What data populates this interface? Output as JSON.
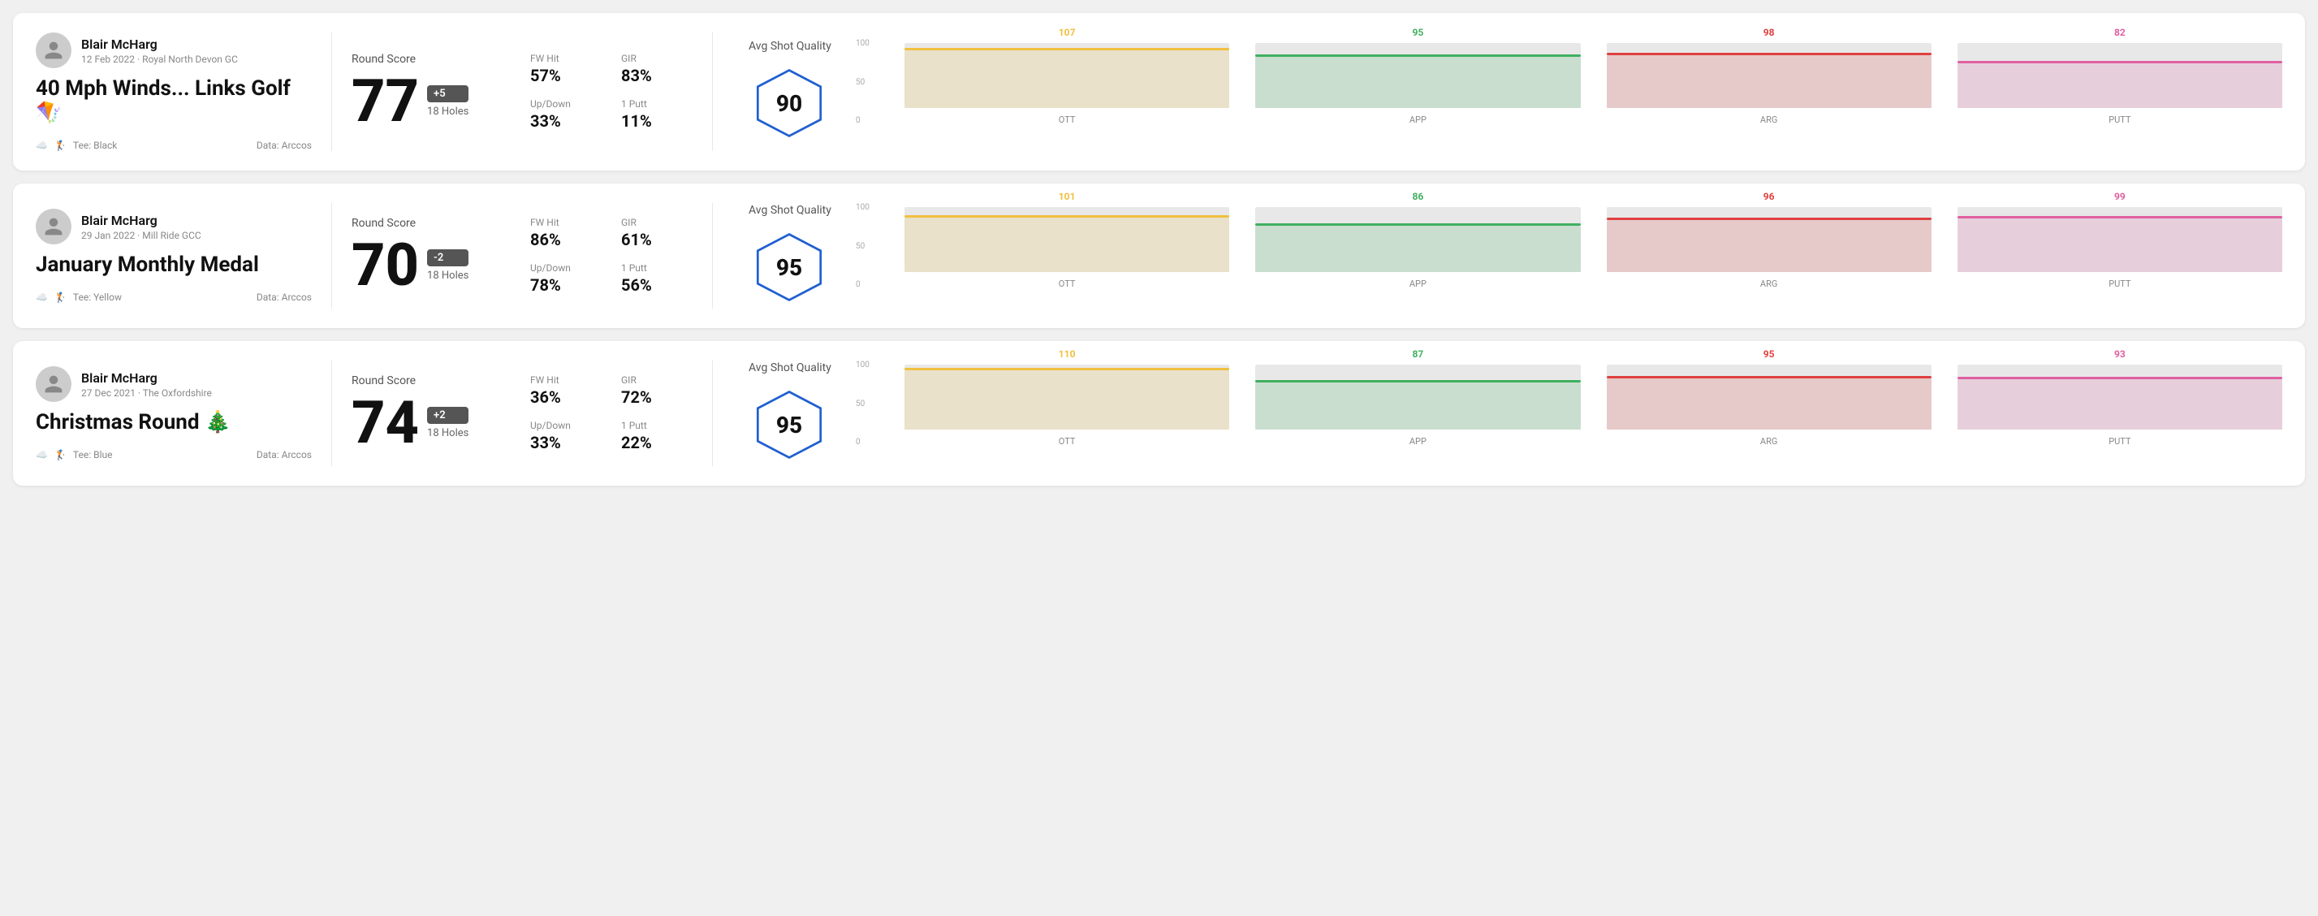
{
  "rounds": [
    {
      "player_name": "Blair McHarg",
      "date": "12 Feb 2022 · Royal North Devon GC",
      "title": "40 Mph Winds... Links Golf",
      "title_emoji": "🪁",
      "tee": "Black",
      "data_source": "Data: Arccos",
      "round_score_label": "Round Score",
      "score": "77",
      "score_diff": "+5",
      "holes": "18 Holes",
      "fw_hit_label": "FW Hit",
      "fw_hit": "57%",
      "gir_label": "GIR",
      "gir": "83%",
      "updown_label": "Up/Down",
      "updown": "33%",
      "oneputt_label": "1 Putt",
      "oneputt": "11%",
      "quality_label": "Avg Shot Quality",
      "quality_score": "90",
      "bars": [
        {
          "label": "OTT",
          "value": 107,
          "color": "#f0c040",
          "max": 120
        },
        {
          "label": "APP",
          "value": 95,
          "color": "#40b060",
          "max": 120
        },
        {
          "label": "ARG",
          "value": 98,
          "color": "#e04040",
          "max": 120
        },
        {
          "label": "PUTT",
          "value": 82,
          "color": "#e060a0",
          "max": 120
        }
      ]
    },
    {
      "player_name": "Blair McHarg",
      "date": "29 Jan 2022 · Mill Ride GCC",
      "title": "January Monthly Medal",
      "title_emoji": "",
      "tee": "Yellow",
      "data_source": "Data: Arccos",
      "round_score_label": "Round Score",
      "score": "70",
      "score_diff": "-2",
      "holes": "18 Holes",
      "fw_hit_label": "FW Hit",
      "fw_hit": "86%",
      "gir_label": "GIR",
      "gir": "61%",
      "updown_label": "Up/Down",
      "updown": "78%",
      "oneputt_label": "1 Putt",
      "oneputt": "56%",
      "quality_label": "Avg Shot Quality",
      "quality_score": "95",
      "bars": [
        {
          "label": "OTT",
          "value": 101,
          "color": "#f0c040",
          "max": 120
        },
        {
          "label": "APP",
          "value": 86,
          "color": "#40b060",
          "max": 120
        },
        {
          "label": "ARG",
          "value": 96,
          "color": "#e04040",
          "max": 120
        },
        {
          "label": "PUTT",
          "value": 99,
          "color": "#e060a0",
          "max": 120
        }
      ]
    },
    {
      "player_name": "Blair McHarg",
      "date": "27 Dec 2021 · The Oxfordshire",
      "title": "Christmas Round",
      "title_emoji": "🎄",
      "tee": "Blue",
      "data_source": "Data: Arccos",
      "round_score_label": "Round Score",
      "score": "74",
      "score_diff": "+2",
      "holes": "18 Holes",
      "fw_hit_label": "FW Hit",
      "fw_hit": "36%",
      "gir_label": "GIR",
      "gir": "72%",
      "updown_label": "Up/Down",
      "updown": "33%",
      "oneputt_label": "1 Putt",
      "oneputt": "22%",
      "quality_label": "Avg Shot Quality",
      "quality_score": "95",
      "bars": [
        {
          "label": "OTT",
          "value": 110,
          "color": "#f0c040",
          "max": 120
        },
        {
          "label": "APP",
          "value": 87,
          "color": "#40b060",
          "max": 120
        },
        {
          "label": "ARG",
          "value": 95,
          "color": "#e04040",
          "max": 120
        },
        {
          "label": "PUTT",
          "value": 93,
          "color": "#e060a0",
          "max": 120
        }
      ]
    }
  ],
  "chart_y_labels": [
    "100",
    "50",
    "0"
  ]
}
